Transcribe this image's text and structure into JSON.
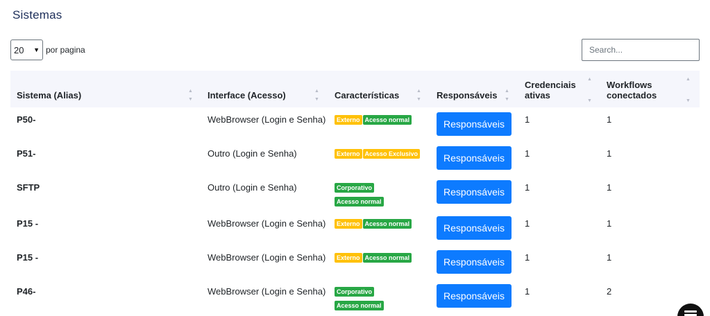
{
  "page": {
    "title": "Sistemas"
  },
  "controls": {
    "page_length": "20",
    "page_length_label": "por pagina",
    "search_placeholder": "Search..."
  },
  "table": {
    "headers": {
      "name": "Sistema (Alias)",
      "interface": "Interface (Acesso)",
      "features": "Características",
      "responsibles": "Responsáveis",
      "credentials_l1": "Credenciais",
      "credentials_l2": "ativas",
      "workflows_l1": "Workflows",
      "workflows_l2": "conectados"
    },
    "rows": [
      {
        "name": "P50-",
        "interface": "WebBrowser (Login e Senha)",
        "badges": [
          {
            "text": "Externo",
            "color": "#ffc107"
          },
          {
            "text": "Acesso normal",
            "color": "#28a745"
          }
        ],
        "button": "Responsáveis",
        "credentials": "1",
        "workflows": "1"
      },
      {
        "name": "P51-",
        "interface": "Outro (Login e Senha)",
        "badges": [
          {
            "text": "Externo",
            "color": "#ffc107"
          },
          {
            "text": "Acesso Exclusivo",
            "color": "#ffc107"
          }
        ],
        "button": "Responsáveis",
        "credentials": "1",
        "workflows": "1"
      },
      {
        "name": "SFTP",
        "interface": "Outro (Login e Senha)",
        "badges": [
          {
            "text": "Corporativo",
            "color": "#28a745"
          },
          {
            "text": "Acesso normal",
            "color": "#28a745"
          }
        ],
        "button": "Responsáveis",
        "credentials": "1",
        "workflows": "1"
      },
      {
        "name": "P15 -",
        "interface": "WebBrowser (Login e Senha)",
        "badges": [
          {
            "text": "Externo",
            "color": "#ffc107"
          },
          {
            "text": "Acesso normal",
            "color": "#28a745"
          }
        ],
        "button": "Responsáveis",
        "credentials": "1",
        "workflows": "1"
      },
      {
        "name": "P15 -",
        "interface": "WebBrowser (Login e Senha)",
        "badges": [
          {
            "text": "Externo",
            "color": "#ffc107"
          },
          {
            "text": "Acesso normal",
            "color": "#28a745"
          }
        ],
        "button": "Responsáveis",
        "credentials": "1",
        "workflows": "1"
      },
      {
        "name": "P46-",
        "interface": "WebBrowser (Login e Senha)",
        "badges": [
          {
            "text": "Corporativo",
            "color": "#28a745"
          },
          {
            "text": "Acesso normal",
            "color": "#28a745"
          }
        ],
        "button": "Responsáveis",
        "credentials": "1",
        "workflows": "2"
      }
    ]
  },
  "icons": {
    "sort": "sort-arrows-icon",
    "select": "chevron-down-icon",
    "fab": "menu-icon"
  }
}
